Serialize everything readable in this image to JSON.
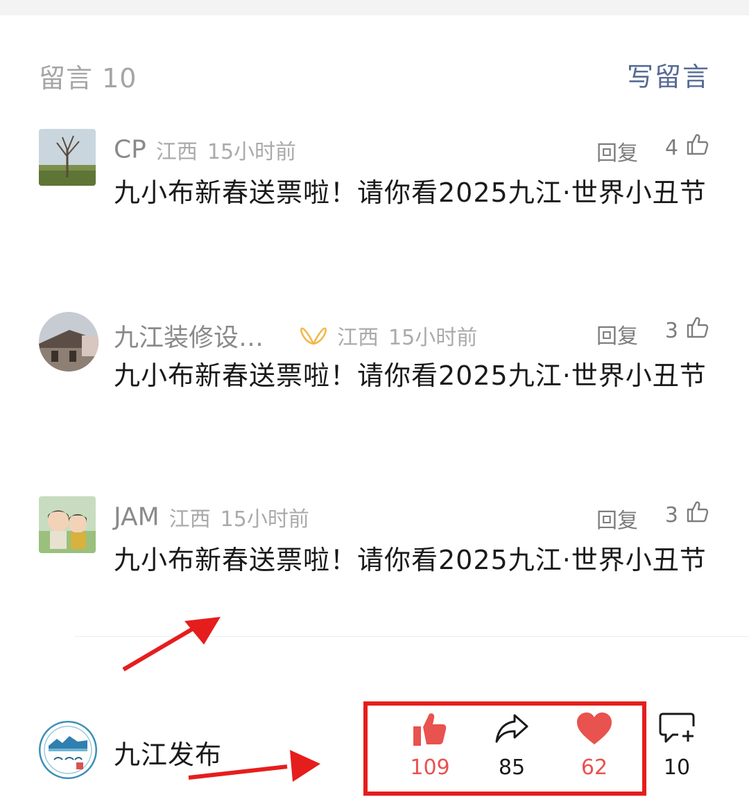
{
  "comments_header": {
    "title": "留言 10",
    "write_label": "写留言"
  },
  "comments": [
    {
      "nickname": "CP",
      "location": "江西",
      "time": "15小时前",
      "reply_label": "回复",
      "likes": "4",
      "text": "九小布新春送票啦！请你看2025九江·世界小丑节"
    },
    {
      "nickname": "九江装修设…",
      "location": "江西",
      "time": "15小时前",
      "reply_label": "回复",
      "likes": "3",
      "text": "九小布新春送票啦！请你看2025九江·世界小丑节"
    },
    {
      "nickname": "JAM",
      "location": "江西",
      "time": "15小时前",
      "reply_label": "回复",
      "likes": "3",
      "text": "九小布新春送票啦！请你看2025九江·世界小丑节"
    }
  ],
  "account": {
    "name": "九江发布"
  },
  "actions": {
    "like_count": "109",
    "share_count": "85",
    "favorite_count": "62",
    "comment_count": "10"
  },
  "colors": {
    "accent": "#576b95",
    "highlight": "#e61d1d",
    "like_red": "#e8524f",
    "butterfly": "#f2b84b"
  }
}
